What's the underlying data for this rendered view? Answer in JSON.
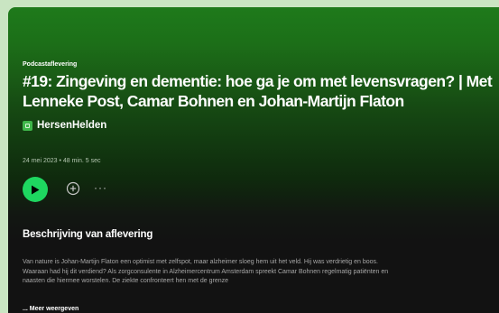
{
  "episode": {
    "kicker": "Podcastaflevering",
    "title": "#19: Zingeving en dementie: hoe ga je om met levensvragen? | Met Lenneke Post, Camar Bohnen en Johan-Martijn Flaton",
    "show_name": "HersenHelden",
    "meta": "24 mei 2023 • 48 min. 5 sec"
  },
  "actions": {
    "play_icon": "play-icon",
    "add_icon": "plus-circle-icon",
    "more_icon": "ellipsis-icon",
    "more_label": "···"
  },
  "description": {
    "heading": "Beschrijving van aflevering",
    "body": "Van nature is Johan-Martijn Flaton een optimist met zelfspot, maar alzheimer sloeg hem uit het veld. Hij was verdrietig en boos. Waaraan had hij dit verdiend? Als zorgconsulente in Alzheimercentrum Amsterdam spreekt Camar Bohnen regelmatig patiënten en naasten die hiermee worstelen. De ziekte confronteert hen met de grenze",
    "show_more": "... Meer weergeven"
  },
  "colors": {
    "accent": "#1ed760",
    "header_green": "#1e7a1b",
    "page_background": "#c9e5c2",
    "text_secondary": "#a7a7a7"
  }
}
